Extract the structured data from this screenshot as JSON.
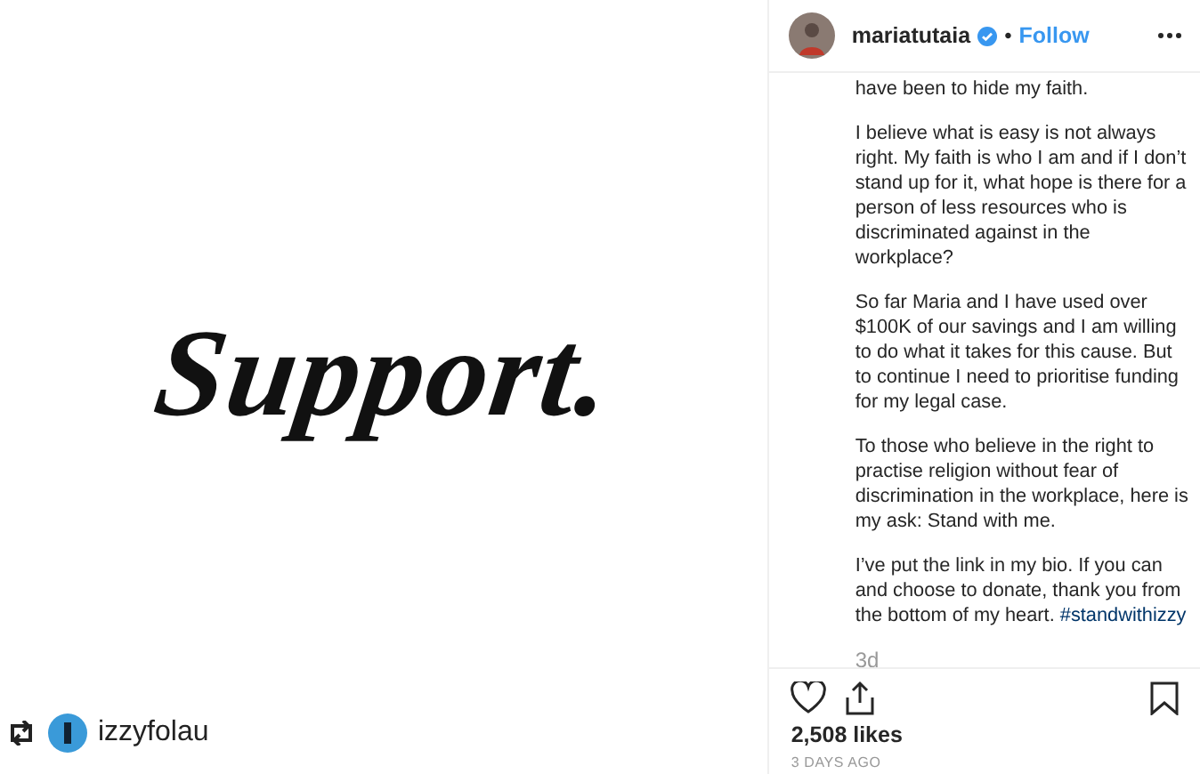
{
  "post_image": {
    "text": "Support.",
    "repost": {
      "username": "izzyfolau"
    }
  },
  "header": {
    "username": "mariatutaia",
    "separator": "•",
    "follow": "Follow"
  },
  "caption": {
    "paragraphs": [
      {
        "text": "have been to hide my faith."
      },
      {
        "text": "I believe what is easy is not always right. My faith is who I am and if I don’t stand up for it, what hope is there for a person of less resources who is discriminated against in the workplace?"
      },
      {
        "text": "So far Maria and I have used over $100K of our savings and I am willing to do what it takes for this cause. But to continue I need to prioritise funding for my legal case."
      },
      {
        "text": "To those who believe in the right to practise religion without fear of discrimination in the workplace, here is my ask: Stand with me."
      },
      {
        "text": "I’ve put the link in my bio. If you can and choose to donate, thank you from the bottom of my heart.",
        "hashtag": "#standwithizzy"
      }
    ],
    "time": "3d"
  },
  "likes": "2,508 likes",
  "date": "3 DAYS AGO"
}
